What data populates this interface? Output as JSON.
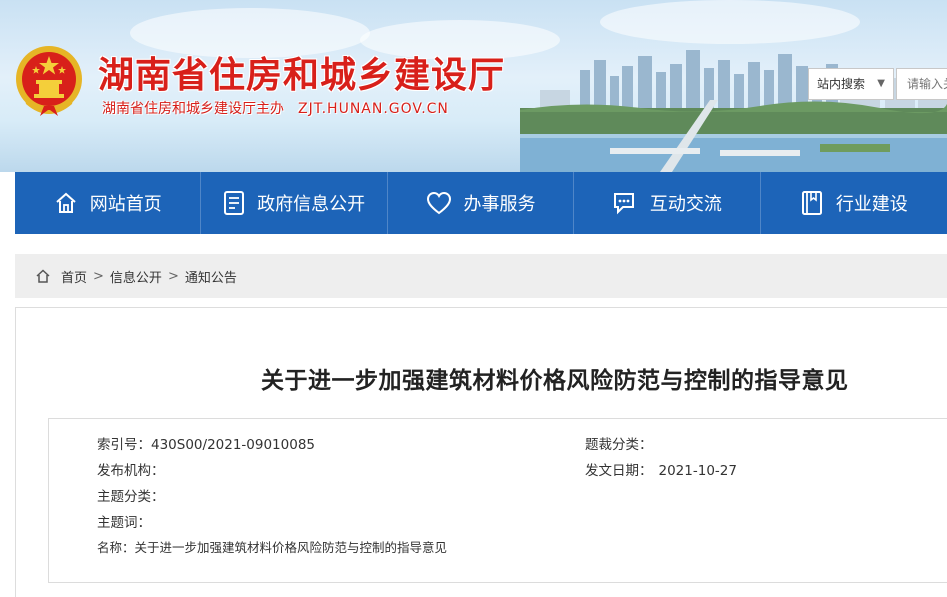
{
  "header": {
    "site_title": "湖南省住房和城乡建设厅",
    "sponsor": "湖南省住房和城乡建设厅主办",
    "domain": "ZJT.HUNAN.GOV.CN",
    "search": {
      "scope_label": "站内搜索",
      "placeholder": "请输入关键字"
    }
  },
  "nav": {
    "items": [
      {
        "label": "网站首页",
        "icon": "home-icon"
      },
      {
        "label": "政府信息公开",
        "icon": "document-icon"
      },
      {
        "label": "办事服务",
        "icon": "heart-icon"
      },
      {
        "label": "互动交流",
        "icon": "chat-icon"
      },
      {
        "label": "行业建设",
        "icon": "book-icon"
      }
    ]
  },
  "breadcrumb": {
    "items": [
      "首页",
      "信息公开",
      "通知公告"
    ],
    "separator": ">"
  },
  "article": {
    "title": "关于进一步加强建筑材料价格风险防范与控制的指导意见",
    "meta": {
      "index_label": "索引号：",
      "index_value": "430S00/2021-09010085",
      "category_label": "题裁分类：",
      "category_value": "",
      "publisher_label": "发布机构：",
      "publisher_value": "",
      "date_label": "发文日期：",
      "date_value": "2021-10-27",
      "topic_label": "主题分类：",
      "topic_value": "",
      "keywords_label": "主题词：",
      "keywords_value": "",
      "name_label": "名称：",
      "name_value": "关于进一步加强建筑材料价格风险防范与控制的指导意见"
    }
  },
  "colors": {
    "brand_red": "#d8201a",
    "nav_blue": "#1d64b8"
  }
}
